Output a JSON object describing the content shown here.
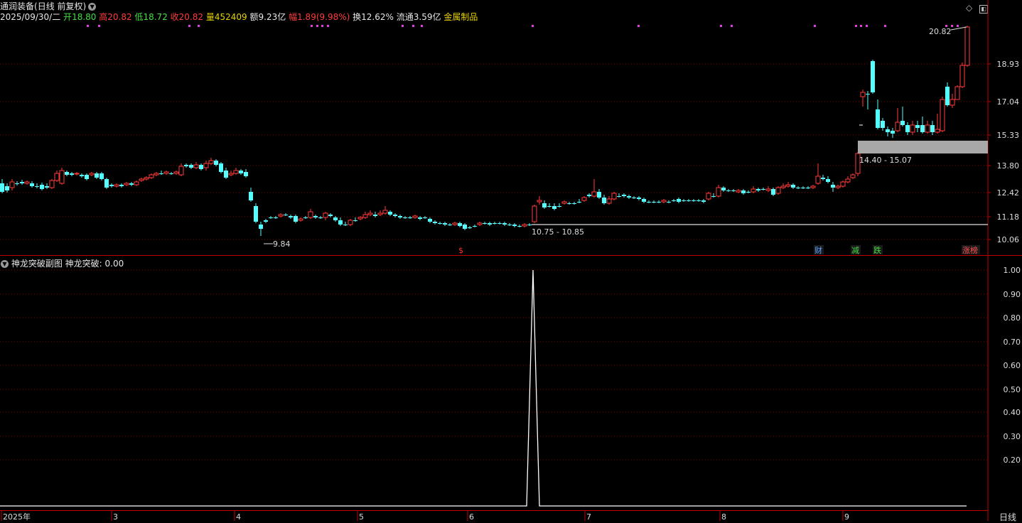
{
  "header": {
    "stock_name": "通润装备",
    "period": "(日线 前复权)",
    "date": "2025/09/30/二",
    "open_label": "开",
    "open_value": "18.80",
    "high_label": "高",
    "high_value": "20.82",
    "low_label": "低",
    "low_value": "18.72",
    "close_label": "收",
    "close_value": "20.82",
    "volume_label": "量",
    "volume_value": "452409",
    "amount_label": "额",
    "amount_value": "9.23亿",
    "change_label": "幅",
    "change_value": "1.89(9.98%)",
    "turnover_label": "换",
    "turnover_value": "12.62%",
    "float_label": "流通",
    "float_value": "3.59亿",
    "sector": "金属制品"
  },
  "top_icons": [
    "diamond-icon",
    "window-icon"
  ],
  "main_chart": {
    "price_axis": [
      "18.93",
      "17.04",
      "15.33",
      "13.80",
      "12.42",
      "11.18",
      "10.06"
    ],
    "high_marker": "20.82",
    "low_marker": "9.84",
    "range_low_label": "10.75 - 10.85",
    "range_high_label": "14.40 - 15.07",
    "events": [
      {
        "text": "$",
        "color": "#ff3030"
      },
      {
        "text": "财",
        "color": "#5aa0ff"
      },
      {
        "text": "减",
        "color": "#44dd44"
      },
      {
        "text": "跌",
        "color": "#44dd44"
      },
      {
        "text": "涨榜",
        "color": "#ff5050"
      }
    ]
  },
  "sub_chart": {
    "title": "神龙突破副图",
    "indicator": "神龙突破: 0.00",
    "axis": [
      "1.00",
      "0.90",
      "0.80",
      "0.70",
      "0.60",
      "0.50",
      "0.40",
      "0.30",
      "0.20"
    ]
  },
  "date_axis": [
    "2025年",
    "3",
    "4",
    "5",
    "6",
    "7",
    "8",
    "9"
  ],
  "period_tab": "日线",
  "colors": {
    "up": "#ff3c3c",
    "down": "#54ffff",
    "grid": "#8b0000",
    "axis": "#c00000"
  }
}
